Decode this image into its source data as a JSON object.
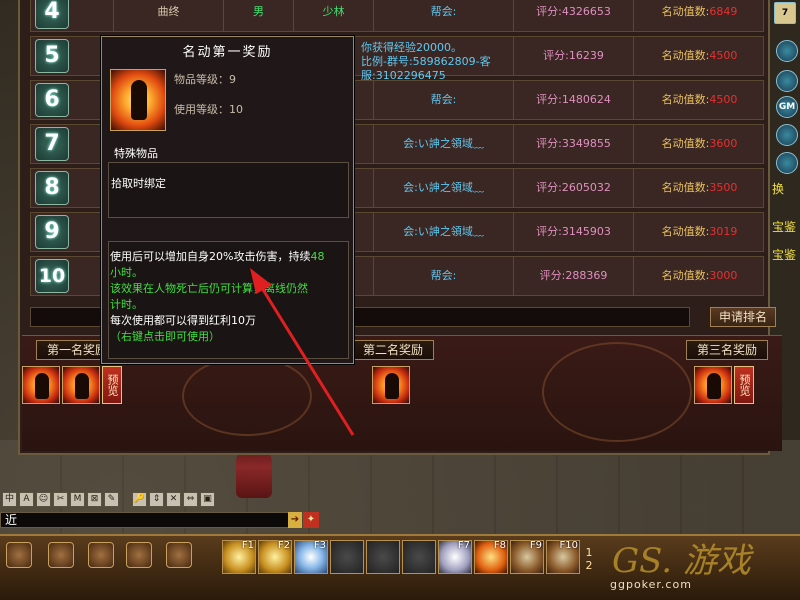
{
  "ranking": {
    "rows": [
      {
        "rank": "4",
        "name": "曲终",
        "gender": "男",
        "school": "少林",
        "guild": "帮会:",
        "score": "评分:4326653",
        "fame_label": "名动值数:",
        "fame_value": "6849"
      },
      {
        "rank": "5",
        "name": "",
        "gender": "",
        "school": "",
        "guild": "",
        "score": "评分:16239",
        "fame_label": "名动值数:",
        "fame_value": "4500"
      },
      {
        "rank": "6",
        "name": "",
        "gender": "",
        "school": "",
        "guild": "帮会:",
        "score": "评分:1480624",
        "fame_label": "名动值数:",
        "fame_value": "4500"
      },
      {
        "rank": "7",
        "name": "",
        "gender": "",
        "school": "",
        "guild": "会:い訷之領域﹏",
        "score": "评分:3349855",
        "fame_label": "名动值数:",
        "fame_value": "3600"
      },
      {
        "rank": "8",
        "name": "",
        "gender": "",
        "school": "",
        "guild": "会:い訷之領域﹏",
        "score": "评分:2605032",
        "fame_label": "名动值数:",
        "fame_value": "3500"
      },
      {
        "rank": "9",
        "name": "",
        "gender": "",
        "school": "",
        "guild": "会:い訷之領域﹏",
        "score": "评分:3145903",
        "fame_label": "名动值数:",
        "fame_value": "3019"
      },
      {
        "rank": "10",
        "name": "",
        "gender": "",
        "school": "",
        "guild": "帮会:",
        "score": "评分:288369",
        "fame_label": "名动值数:",
        "fame_value": "3000"
      }
    ],
    "row5_system_line1": "你获得经验20000。",
    "row5_system_line2": "比例-群号:589862809-客服:3102296475",
    "apply_button": "申请排名"
  },
  "rewards": {
    "first_label": "第一名奖励",
    "second_label": "第二名奖励",
    "third_label": "第三名奖励",
    "preview_label": "预览"
  },
  "tooltip": {
    "title": "名动第一奖励",
    "item_level": "物品等级：9",
    "use_level": "使用等级：10",
    "category": "特殊物品",
    "bind": "拾取时绑定",
    "desc_line1a": "使用后可以增加自身20%攻击伤害，持续",
    "desc_line1b": "48",
    "desc_line2": "小时。",
    "desc_line3": "该效果在人物死亡后仍可计算，离线仍然",
    "desc_line4": "计时。",
    "desc_line5": "每次使用都可以得到红利10万",
    "desc_line6": "（右键点击即可使用）"
  },
  "side": {
    "top_num": "7",
    "gm_label": "GM",
    "text_huan": "换",
    "text_bao1": "宝鉴",
    "text_bao2": "宝鉴"
  },
  "chat": {
    "channel": "近",
    "input_value": "",
    "go_label": "➔",
    "toolbar": [
      "中",
      "A",
      "☺",
      "✂",
      "M",
      "⊠",
      "✎",
      "🔑",
      "⇕",
      "✕",
      "⇔",
      "▣"
    ]
  },
  "skills": [
    "F1",
    "F2",
    "F3",
    "",
    "",
    "",
    "F7",
    "F8",
    "F9",
    "F10"
  ],
  "page_numbers": [
    "1",
    "2"
  ],
  "logo": {
    "text": "GS. 游戏",
    "sub": "ggpoker.com"
  },
  "colors": {
    "arrow": "#e02020",
    "panel": "#2e1e1a",
    "fame_red": "#e83030"
  }
}
